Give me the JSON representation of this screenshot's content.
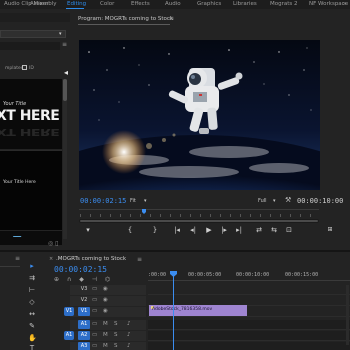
{
  "workspace_bar": {
    "items": [
      "Audio Clip Mixer",
      "Assembly",
      "Editing",
      "Color",
      "Effects",
      "Audio",
      "Graphics",
      "Libraries",
      "Mograts 2",
      "NF Workspace"
    ],
    "active": "Editing",
    "more_glyph": "»"
  },
  "left_panel": {
    "tab_label": "Audio Clip Mixer",
    "menu_glyph": "≡",
    "templates_label": "mplates",
    "checkbox_label": "ID",
    "thumb1_small": "Your Title",
    "thumb1_big": "XT HERE",
    "thumb2_text": "Your Title Here",
    "bottom_icons": "◎ ▯"
  },
  "program_monitor": {
    "title": "Program: MOGRTs coming to Stock",
    "menu_glyph": "≡",
    "timecode_current": "00:00:02:15",
    "fit_label": "Fit",
    "quality_label": "Full",
    "timecode_duration": "00:00:10:00",
    "transport": [
      "▾",
      "{",
      "}",
      "|◂",
      "◂|",
      "▶",
      "|▸",
      "▸|",
      "⇄",
      "⇆",
      "⊡"
    ]
  },
  "timeline": {
    "tab_title": ".MOGRTs coming to Stock",
    "close_glyph": "×",
    "menu_glyph": "≡",
    "timecode": "00:00:02:15",
    "tool_icons": "⊕ ∩ ◆ ⊣ ⌬",
    "ruler_labels": [
      ":00:00",
      "00:00:05:00",
      "00:00:10:00",
      "00:00:15:00"
    ],
    "tracks": [
      {
        "src": "",
        "name": "V3",
        "type": "video"
      },
      {
        "src": "",
        "name": "V2",
        "type": "video"
      },
      {
        "src": "V1",
        "name": "V1",
        "type": "video"
      },
      {
        "src": "",
        "name": "A1",
        "type": "audio"
      },
      {
        "src": "A1",
        "name": "A2",
        "type": "audio"
      },
      {
        "src": "",
        "name": "A3",
        "type": "audio"
      }
    ],
    "clip_label": "AdobeStock_7816358.mov",
    "clip_color": "#9f85d1"
  },
  "tools": {
    "items": [
      "selection",
      "track-select",
      "ripple-edit",
      "razor",
      "slip",
      "pen",
      "hand",
      "type"
    ]
  },
  "colors": {
    "accent": "#3b8df0",
    "panel_bg": "#232323",
    "clip": "#9f85d1"
  }
}
